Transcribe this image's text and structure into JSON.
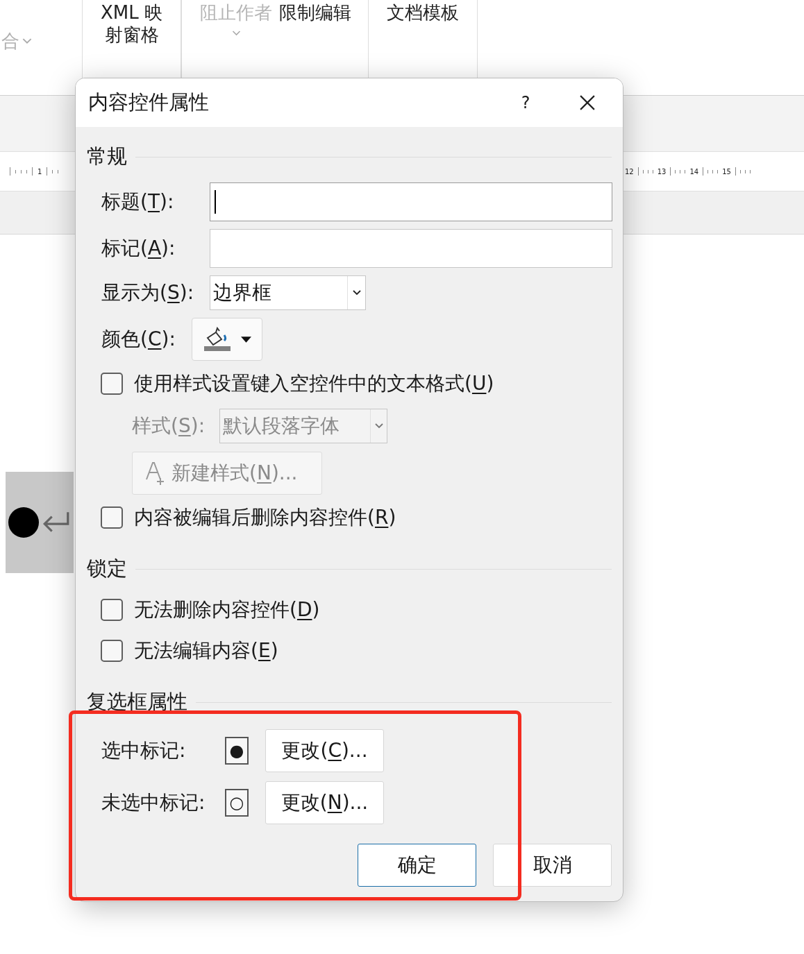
{
  "ribbon": {
    "left_item": {
      "text": "合",
      "disabled": true
    },
    "items": [
      {
        "lines": [
          "XML 映",
          "射窗格"
        ],
        "disabled": false
      },
      {
        "lines": [
          "阻止作者"
        ],
        "disabled": true,
        "dropdown": true
      },
      {
        "lines": [
          "限制编辑"
        ],
        "disabled": false
      },
      {
        "lines": [
          "文档模板"
        ],
        "disabled": false
      }
    ]
  },
  "ruler": {
    "left_labels": [
      "1"
    ],
    "right_labels": [
      "12",
      "13",
      "14",
      "15"
    ]
  },
  "dialog": {
    "title": "内容控件属性",
    "help": "?",
    "general": {
      "title": "常规",
      "title_field": {
        "label": [
          "标题(",
          "T",
          "):"
        ],
        "focused": true
      },
      "tag_field": {
        "label": [
          "标记(",
          "A",
          "):"
        ],
        "focused": false
      },
      "show_as": {
        "label": [
          "显示为(",
          "S",
          "):"
        ],
        "value": "边界框"
      },
      "color": {
        "label": [
          "颜色(",
          "C",
          "):"
        ]
      },
      "use_style": {
        "label": [
          "使用样式设置键入空控件中的文本格式(",
          "U",
          ")"
        ],
        "checked": false
      },
      "style": {
        "label": [
          "样式(",
          "S",
          "):"
        ],
        "value": "默认段落字体",
        "disabled": true
      },
      "new_style": {
        "label": [
          "新建样式(",
          "N",
          ")..."
        ],
        "disabled": true
      },
      "remove_after_edit": {
        "label": [
          "内容被编辑后删除内容控件(",
          "R",
          ")"
        ],
        "checked": false
      }
    },
    "locking": {
      "title": "锁定",
      "options": [
        {
          "label": [
            "无法删除内容控件(",
            "D",
            ")"
          ],
          "checked": false
        },
        {
          "label": [
            "无法编辑内容(",
            "E",
            ")"
          ],
          "checked": false
        }
      ]
    },
    "checkbox_properties": {
      "title": "复选框属性",
      "rows": [
        {
          "label": "选中标记:",
          "symbol": "●",
          "button": [
            "更改(",
            "C",
            ")..."
          ]
        },
        {
          "label": "未选中标记:",
          "symbol": "○",
          "button": [
            "更改(",
            "N",
            ")..."
          ]
        }
      ]
    },
    "buttons": [
      {
        "label": "确定",
        "default": true
      },
      {
        "label": "取消",
        "default": false
      }
    ]
  }
}
